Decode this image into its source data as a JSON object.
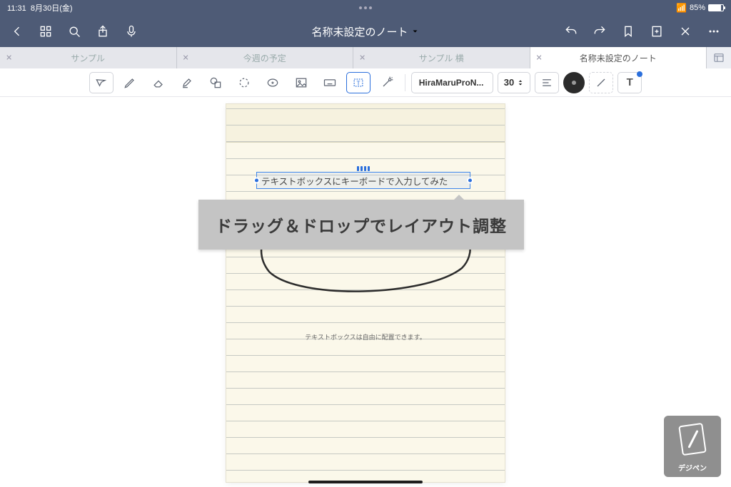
{
  "status": {
    "time": "11:31",
    "date": "8月30日(金)",
    "battery": "85%"
  },
  "nav": {
    "title": "名称未設定のノート"
  },
  "tabs": [
    {
      "label": "サンプル",
      "active": false
    },
    {
      "label": "今週の予定",
      "active": false
    },
    {
      "label": "サンプル 横",
      "active": false
    },
    {
      "label": "名称未設定のノート",
      "active": true
    }
  ],
  "toolbar": {
    "font_name": "HiraMaruProN...",
    "font_size": "30"
  },
  "page": {
    "selected_text": "テキストボックスにキーボードで入力してみた",
    "hint_text": "テキストボックスは自由に配置できます。"
  },
  "callout": "ドラッグ＆ドロップでレイアウト調整",
  "brand": "デジペン"
}
